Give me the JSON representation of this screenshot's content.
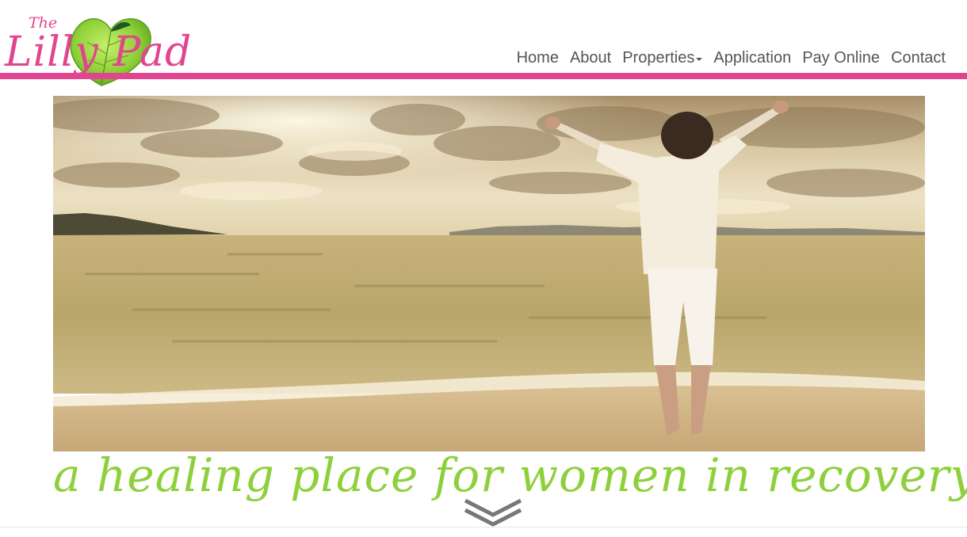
{
  "brand": {
    "logo_the": "The",
    "logo_name": "Lilly Pad",
    "logo_icon": "lily-pad-heart-icon",
    "pink": "#e2458f",
    "green": "#8dd03c"
  },
  "nav": {
    "items": [
      {
        "label": "Home"
      },
      {
        "label": "About"
      },
      {
        "label": "Properties",
        "has_dropdown": true
      },
      {
        "label": "Application"
      },
      {
        "label": "Pay Online"
      },
      {
        "label": "Contact"
      }
    ]
  },
  "hero": {
    "image": "woman-arms-raised-on-beach-at-sunset"
  },
  "tagline": "a healing place for women in recovery",
  "scroll_icon": "chevron-down-icon"
}
